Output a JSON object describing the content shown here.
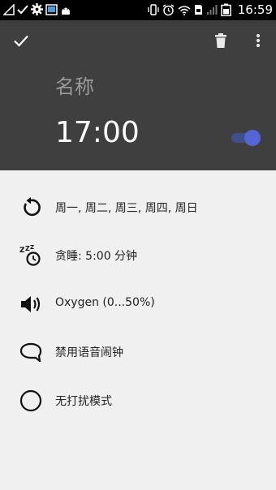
{
  "status_bar": {
    "time": "16:59",
    "left_icons": [
      "signal-flag-icon",
      "check-icon",
      "gear-icon",
      "gallery-icon",
      "android-icon"
    ],
    "right_icons": [
      "vibrate-icon",
      "alarm-clock-icon",
      "wifi-icon",
      "sim-icon",
      "cell-signal-icon",
      "battery-icon"
    ]
  },
  "toolbar": {
    "confirm_icon": "check-icon",
    "delete_icon": "trash-icon",
    "more_icon": "more-vert-icon"
  },
  "alarm": {
    "name_placeholder": "名称",
    "time": "17:00",
    "enabled": true
  },
  "settings": {
    "items": [
      {
        "icon": "repeat-icon",
        "label": "周一, 周二, 周三, 周四, 周日"
      },
      {
        "icon": "snooze-icon",
        "label": "贪睡: 5:00 分钟"
      },
      {
        "icon": "volume-icon",
        "label": "Oxygen (0...50%)"
      },
      {
        "icon": "speech-bubble-icon",
        "label": "禁用语音闹钟"
      },
      {
        "icon": "circle-icon",
        "label": "无打扰模式"
      }
    ]
  },
  "colors": {
    "header_bg": "#3f3f3f",
    "toggle_accent": "#5565d6",
    "settings_bg": "#f0f0f0"
  }
}
